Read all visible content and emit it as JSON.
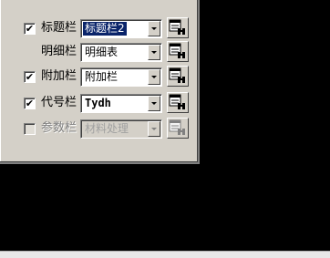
{
  "rows": [
    {
      "label": "标题栏",
      "checked": "✔",
      "value": "标题栏2"
    },
    {
      "label": "明细栏",
      "checked": "",
      "value": "明细表"
    },
    {
      "label": "附加栏",
      "checked": "✔",
      "value": "附加栏"
    },
    {
      "label": "代号栏",
      "checked": "✔",
      "value": "Tydh"
    },
    {
      "label": "参数栏",
      "checked": "",
      "value": "材料处理"
    }
  ],
  "icons": {
    "browse": "browse-icon"
  }
}
